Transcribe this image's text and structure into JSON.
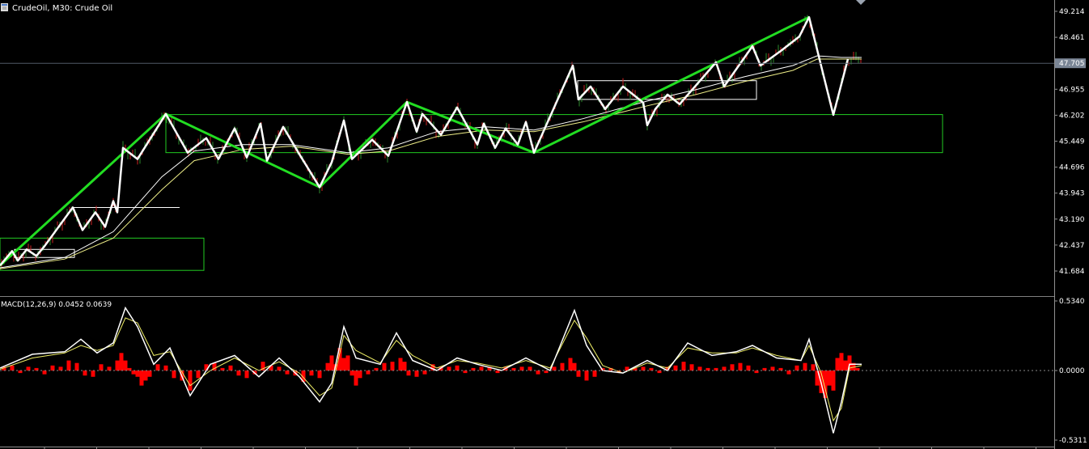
{
  "window": {
    "title": "CrudeOil, M30:  Crude Oil",
    "icon": "chart-window-icon",
    "indicator_label": "MACD(12,26,9) 0.0452 0.0639"
  },
  "colors": {
    "background": "#000000",
    "zigzag_major": "#22dd22",
    "zigzag_minor": "#ffffff",
    "zone_box_green": "#22cc22",
    "zone_box_white": "#ffffff",
    "ma_fast": "#ffffff",
    "ma_slow": "#eeee88",
    "candles": "#cc2222",
    "macd_line": "#ffffff",
    "signal_line": "#eeee66",
    "histogram": "#ff0000",
    "price_marker_bg": "#7a8595",
    "grid": "#505a66"
  },
  "chart_data": [
    {
      "type": "line",
      "title": "CrudeOil, M30:  Crude Oil",
      "price_axis_ticks": [
        "49.214",
        "48.461",
        "47.705",
        "46.955",
        "46.202",
        "45.449",
        "44.696",
        "43.943",
        "43.190",
        "42.437",
        "41.684"
      ],
      "current_price": "47.705",
      "ylim": [
        41.38,
        49.43
      ],
      "zigzag_major": [
        [
          0,
          41.55
        ],
        [
          205,
          46.25
        ],
        [
          395,
          43.98
        ],
        [
          503,
          46.62
        ],
        [
          660,
          45.05
        ],
        [
          1000,
          49.25
        ]
      ],
      "zigzag_minor": [
        [
          0,
          41.55
        ],
        [
          15,
          42.0
        ],
        [
          22,
          41.7
        ],
        [
          33,
          42.05
        ],
        [
          45,
          41.85
        ],
        [
          55,
          42.15
        ],
        [
          90,
          43.35
        ],
        [
          102,
          42.65
        ],
        [
          118,
          43.2
        ],
        [
          130,
          42.75
        ],
        [
          140,
          43.55
        ],
        [
          145,
          43.2
        ],
        [
          152,
          45.2
        ],
        [
          170,
          44.85
        ],
        [
          205,
          46.25
        ],
        [
          215,
          45.8
        ],
        [
          232,
          45.05
        ],
        [
          255,
          45.5
        ],
        [
          270,
          44.85
        ],
        [
          290,
          45.8
        ],
        [
          305,
          44.9
        ],
        [
          322,
          45.95
        ],
        [
          330,
          44.8
        ],
        [
          350,
          45.85
        ],
        [
          370,
          45.0
        ],
        [
          395,
          43.98
        ],
        [
          410,
          44.75
        ],
        [
          425,
          46.05
        ],
        [
          435,
          44.85
        ],
        [
          460,
          45.45
        ],
        [
          480,
          44.95
        ],
        [
          503,
          46.62
        ],
        [
          515,
          45.7
        ],
        [
          522,
          46.25
        ],
        [
          545,
          45.6
        ],
        [
          565,
          46.45
        ],
        [
          590,
          45.3
        ],
        [
          598,
          45.95
        ],
        [
          612,
          45.2
        ],
        [
          625,
          45.8
        ],
        [
          640,
          45.3
        ],
        [
          650,
          46.0
        ],
        [
          660,
          45.05
        ],
        [
          708,
          47.75
        ],
        [
          715,
          46.7
        ],
        [
          730,
          47.1
        ],
        [
          748,
          46.4
        ],
        [
          770,
          47.1
        ],
        [
          795,
          46.6
        ],
        [
          800,
          45.9
        ],
        [
          810,
          46.4
        ],
        [
          825,
          46.85
        ],
        [
          840,
          46.55
        ],
        [
          885,
          47.85
        ],
        [
          895,
          47.1
        ],
        [
          930,
          48.35
        ],
        [
          940,
          47.75
        ],
        [
          965,
          48.2
        ],
        [
          988,
          48.65
        ],
        [
          1000,
          49.25
        ],
        [
          1030,
          46.22
        ],
        [
          1048,
          47.95
        ]
      ],
      "zone_boxes": [
        {
          "color": "green",
          "x_start": 0,
          "x_end": 252,
          "top": 42.4,
          "bottom": 41.4
        },
        {
          "color": "green",
          "x_start": 205,
          "x_end": 1165,
          "top": 46.23,
          "bottom": 45.05
        },
        {
          "color": "white",
          "x_start": 18,
          "x_end": 92,
          "top": 42.05,
          "bottom": 41.8
        },
        {
          "color": "white",
          "x_start": 714,
          "x_end": 935,
          "top": 47.28,
          "bottom": 46.7
        }
      ],
      "level_lines": [
        {
          "x_start": 90,
          "x_end": 222,
          "price": 43.35
        }
      ],
      "ma_fast": [
        [
          0,
          41.48
        ],
        [
          80,
          41.8
        ],
        [
          140,
          42.6
        ],
        [
          200,
          44.3
        ],
        [
          240,
          45.1
        ],
        [
          300,
          45.3
        ],
        [
          360,
          45.3
        ],
        [
          430,
          45.05
        ],
        [
          480,
          45.2
        ],
        [
          540,
          45.7
        ],
        [
          600,
          45.85
        ],
        [
          660,
          45.75
        ],
        [
          720,
          46.1
        ],
        [
          800,
          46.65
        ],
        [
          860,
          47.0
        ],
        [
          920,
          47.4
        ],
        [
          980,
          47.75
        ],
        [
          1010,
          48.05
        ],
        [
          1040,
          48.0
        ],
        [
          1065,
          48.0
        ]
      ],
      "ma_slow": [
        [
          0,
          41.45
        ],
        [
          80,
          41.75
        ],
        [
          140,
          42.4
        ],
        [
          200,
          43.9
        ],
        [
          240,
          44.8
        ],
        [
          300,
          45.15
        ],
        [
          360,
          45.25
        ],
        [
          430,
          45.0
        ],
        [
          480,
          45.1
        ],
        [
          540,
          45.55
        ],
        [
          600,
          45.75
        ],
        [
          660,
          45.7
        ],
        [
          720,
          46.0
        ],
        [
          800,
          46.5
        ],
        [
          860,
          46.85
        ],
        [
          920,
          47.25
        ],
        [
          980,
          47.6
        ],
        [
          1010,
          47.95
        ],
        [
          1040,
          47.95
        ],
        [
          1065,
          47.95
        ]
      ]
    },
    {
      "type": "line",
      "title": "MACD(12,26,9) 0.0452 0.0639",
      "axis_ticks": [
        "0.5340",
        "0.0000",
        "-0.5311"
      ],
      "ylim": [
        -0.555,
        0.555
      ],
      "macd_line": [
        [
          0,
          0.02
        ],
        [
          40,
          0.13
        ],
        [
          80,
          0.15
        ],
        [
          100,
          0.25
        ],
        [
          120,
          0.14
        ],
        [
          140,
          0.22
        ],
        [
          155,
          0.5
        ],
        [
          170,
          0.35
        ],
        [
          190,
          0.05
        ],
        [
          210,
          0.18
        ],
        [
          235,
          -0.2
        ],
        [
          260,
          0.05
        ],
        [
          290,
          0.12
        ],
        [
          320,
          -0.05
        ],
        [
          345,
          0.1
        ],
        [
          370,
          -0.05
        ],
        [
          395,
          -0.25
        ],
        [
          410,
          -0.1
        ],
        [
          425,
          0.35
        ],
        [
          440,
          0.1
        ],
        [
          470,
          0.05
        ],
        [
          490,
          0.3
        ],
        [
          510,
          0.08
        ],
        [
          540,
          0.0
        ],
        [
          565,
          0.1
        ],
        [
          590,
          0.05
        ],
        [
          620,
          0.0
        ],
        [
          650,
          0.1
        ],
        [
          680,
          0.0
        ],
        [
          710,
          0.48
        ],
        [
          725,
          0.2
        ],
        [
          745,
          0.0
        ],
        [
          770,
          -0.02
        ],
        [
          800,
          0.08
        ],
        [
          825,
          0.0
        ],
        [
          850,
          0.22
        ],
        [
          880,
          0.12
        ],
        [
          910,
          0.15
        ],
        [
          930,
          0.2
        ],
        [
          960,
          0.1
        ],
        [
          990,
          0.08
        ],
        [
          1000,
          0.25
        ],
        [
          1015,
          -0.1
        ],
        [
          1030,
          -0.5
        ],
        [
          1040,
          -0.25
        ],
        [
          1050,
          0.05
        ],
        [
          1065,
          0.05
        ]
      ],
      "signal_line": [
        [
          0,
          0.01
        ],
        [
          40,
          0.1
        ],
        [
          80,
          0.14
        ],
        [
          100,
          0.2
        ],
        [
          120,
          0.16
        ],
        [
          140,
          0.2
        ],
        [
          155,
          0.42
        ],
        [
          170,
          0.38
        ],
        [
          190,
          0.12
        ],
        [
          210,
          0.15
        ],
        [
          235,
          -0.12
        ],
        [
          260,
          0.0
        ],
        [
          290,
          0.1
        ],
        [
          320,
          0.0
        ],
        [
          345,
          0.07
        ],
        [
          370,
          -0.02
        ],
        [
          395,
          -0.2
        ],
        [
          410,
          -0.14
        ],
        [
          425,
          0.28
        ],
        [
          440,
          0.16
        ],
        [
          470,
          0.06
        ],
        [
          490,
          0.24
        ],
        [
          510,
          0.12
        ],
        [
          540,
          0.02
        ],
        [
          565,
          0.08
        ],
        [
          590,
          0.06
        ],
        [
          620,
          0.02
        ],
        [
          650,
          0.08
        ],
        [
          680,
          0.02
        ],
        [
          710,
          0.4
        ],
        [
          725,
          0.26
        ],
        [
          745,
          0.04
        ],
        [
          770,
          -0.02
        ],
        [
          800,
          0.06
        ],
        [
          825,
          0.02
        ],
        [
          850,
          0.18
        ],
        [
          880,
          0.14
        ],
        [
          910,
          0.14
        ],
        [
          930,
          0.18
        ],
        [
          960,
          0.12
        ],
        [
          990,
          0.08
        ],
        [
          1000,
          0.2
        ],
        [
          1015,
          -0.02
        ],
        [
          1030,
          -0.4
        ],
        [
          1040,
          -0.3
        ],
        [
          1050,
          0.02
        ],
        [
          1065,
          0.04
        ]
      ],
      "histogram": [
        [
          5,
          0.03
        ],
        [
          15,
          0.04
        ],
        [
          25,
          -0.02
        ],
        [
          35,
          0.03
        ],
        [
          45,
          0.02
        ],
        [
          55,
          -0.03
        ],
        [
          65,
          0.04
        ],
        [
          75,
          0.03
        ],
        [
          85,
          0.08
        ],
        [
          95,
          0.06
        ],
        [
          105,
          -0.04
        ],
        [
          115,
          -0.05
        ],
        [
          125,
          0.05
        ],
        [
          135,
          0.03
        ],
        [
          145,
          0.08
        ],
        [
          150,
          0.14
        ],
        [
          155,
          0.08
        ],
        [
          160,
          0.02
        ],
        [
          165,
          -0.03
        ],
        [
          170,
          -0.05
        ],
        [
          175,
          -0.12
        ],
        [
          180,
          -0.08
        ],
        [
          185,
          -0.05
        ],
        [
          195,
          0.05
        ],
        [
          205,
          0.04
        ],
        [
          215,
          -0.06
        ],
        [
          225,
          -0.08
        ],
        [
          235,
          -0.16
        ],
        [
          245,
          -0.06
        ],
        [
          255,
          0.05
        ],
        [
          265,
          0.06
        ],
        [
          275,
          0.02
        ],
        [
          285,
          0.04
        ],
        [
          295,
          -0.04
        ],
        [
          305,
          -0.06
        ],
        [
          315,
          -0.03
        ],
        [
          325,
          0.07
        ],
        [
          335,
          0.04
        ],
        [
          345,
          0.03
        ],
        [
          355,
          -0.03
        ],
        [
          365,
          -0.04
        ],
        [
          375,
          -0.09
        ],
        [
          385,
          -0.04
        ],
        [
          395,
          -0.06
        ],
        [
          405,
          0.06
        ],
        [
          410,
          0.12
        ],
        [
          415,
          0.05
        ],
        [
          420,
          0.18
        ],
        [
          425,
          0.1
        ],
        [
          430,
          0.12
        ],
        [
          435,
          -0.04
        ],
        [
          440,
          -0.12
        ],
        [
          445,
          -0.06
        ],
        [
          455,
          -0.03
        ],
        [
          465,
          0.02
        ],
        [
          475,
          0.06
        ],
        [
          485,
          0.07
        ],
        [
          495,
          0.1
        ],
        [
          500,
          0.07
        ],
        [
          505,
          -0.04
        ],
        [
          515,
          -0.05
        ],
        [
          525,
          -0.03
        ],
        [
          535,
          0.05
        ],
        [
          545,
          0.03
        ],
        [
          555,
          0.03
        ],
        [
          565,
          0.04
        ],
        [
          575,
          -0.02
        ],
        [
          585,
          0.02
        ],
        [
          595,
          0.03
        ],
        [
          605,
          0.03
        ],
        [
          615,
          -0.02
        ],
        [
          625,
          0.03
        ],
        [
          635,
          0.02
        ],
        [
          645,
          0.03
        ],
        [
          655,
          0.03
        ],
        [
          665,
          -0.03
        ],
        [
          675,
          -0.02
        ],
        [
          685,
          0.03
        ],
        [
          695,
          0.06
        ],
        [
          705,
          0.1
        ],
        [
          710,
          0.06
        ],
        [
          715,
          -0.05
        ],
        [
          725,
          -0.08
        ],
        [
          735,
          -0.05
        ],
        [
          745,
          0.02
        ],
        [
          755,
          0.02
        ],
        [
          765,
          -0.02
        ],
        [
          775,
          0.03
        ],
        [
          785,
          0.02
        ],
        [
          795,
          0.03
        ],
        [
          805,
          0.02
        ],
        [
          815,
          -0.02
        ],
        [
          825,
          0.03
        ],
        [
          835,
          0.04
        ],
        [
          845,
          0.07
        ],
        [
          855,
          0.05
        ],
        [
          865,
          0.03
        ],
        [
          875,
          0.02
        ],
        [
          885,
          0.02
        ],
        [
          895,
          0.03
        ],
        [
          905,
          0.05
        ],
        [
          915,
          0.06
        ],
        [
          925,
          0.04
        ],
        [
          935,
          -0.02
        ],
        [
          945,
          0.02
        ],
        [
          955,
          0.03
        ],
        [
          965,
          0.02
        ],
        [
          975,
          -0.03
        ],
        [
          985,
          0.04
        ],
        [
          995,
          0.06
        ],
        [
          1005,
          0.05
        ],
        [
          1010,
          -0.12
        ],
        [
          1015,
          -0.18
        ],
        [
          1020,
          -0.22
        ],
        [
          1025,
          -0.12
        ],
        [
          1030,
          -0.16
        ],
        [
          1035,
          0.1
        ],
        [
          1040,
          0.14
        ],
        [
          1045,
          0.08
        ],
        [
          1050,
          0.12
        ],
        [
          1055,
          0.06
        ],
        [
          1060,
          0.02
        ]
      ]
    }
  ]
}
